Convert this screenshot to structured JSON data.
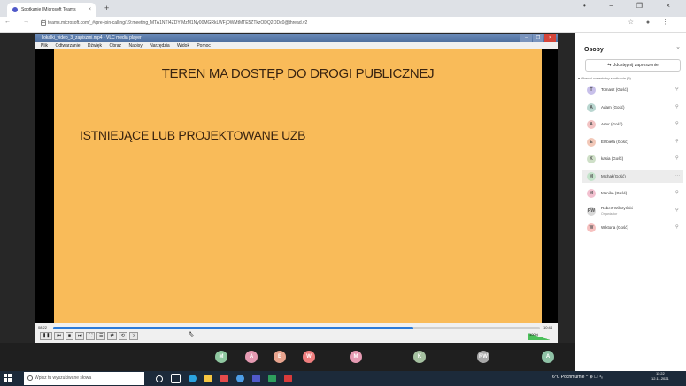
{
  "browser": {
    "tab_title": "Spotkanie (Microsoft Teams",
    "new_tab": "+",
    "url": "teams.microsoft.com/_#/pre-join-calling/19:meeting_MTA1NTI4ZDYtMzM1Ny00MGRkLWFjOWMtMTE5ZTkzODQ2ODc0@thread.v2",
    "nav": "← → C",
    "window_controls": "• − ❐ ×",
    "addr_icons": "☆ ● ⋮"
  },
  "vlc": {
    "title": "lokalki_video_3_zapiszmi.mp4 - VLC media player",
    "menu": [
      "Plik",
      "Odtwarzanie",
      "Dźwięk",
      "Obraz",
      "Napisy",
      "Narzędzia",
      "Widok",
      "Pomoc"
    ],
    "time_elapsed": "08:22",
    "time_total": "10:44",
    "progress": 0.74,
    "volume": "100%",
    "buttons": [
      "❚❚",
      "⏮",
      "■",
      "⏭",
      "⛶",
      "☰",
      "⇄",
      "⟲",
      "⤨"
    ]
  },
  "slide": {
    "title": "TEREN MA DOSTĘP DO DROGI PUBLICZNEJ",
    "bullet": "ISTNIEJĄCE LUB PROJEKTOWANE UZB"
  },
  "meeting_avatars": [
    {
      "initials": "M",
      "color": "#8fc7a0"
    },
    {
      "initials": "A",
      "color": "#e59ab2"
    },
    {
      "initials": "E",
      "color": "#e8a48e"
    },
    {
      "initials": "W",
      "color": "#ef7e7e"
    },
    {
      "initials": "M",
      "color": "#e59ab2"
    },
    {
      "initials": "K",
      "color": "#a5c0a0"
    },
    {
      "initials": "RW",
      "color": "#a8a8a8"
    },
    {
      "initials": "A",
      "color": "#8fc2a6"
    }
  ],
  "panel": {
    "title": "Osoby",
    "close": "×",
    "share_button": "Udostępnij zaproszenie",
    "section_label": "Obecni uczestnicy spotkania (9)",
    "participants": [
      {
        "initials": "T",
        "name": "Tomasz (Gość)",
        "color": "#c8c0ea"
      },
      {
        "initials": "A",
        "name": "Adam (Gość)",
        "color": "#b9d6d0"
      },
      {
        "initials": "A",
        "name": "Artur (Gość)",
        "color": "#f2c3c3"
      },
      {
        "initials": "E",
        "name": "Elżbieta (Gość)",
        "color": "#f2c8b8"
      },
      {
        "initials": "K",
        "name": "kasia (Gość)",
        "color": "#cfe0c8"
      },
      {
        "initials": "M",
        "name": "Michał (Gość)",
        "color": "#c4e3cb"
      },
      {
        "initials": "M",
        "name": "Monika (Gość)",
        "color": "#f2c0cf"
      },
      {
        "initials": "RW",
        "name": "Robert Wilczyński",
        "color": "#d8d8d8",
        "sub": "Organizator"
      },
      {
        "initials": "W",
        "name": "Wiktoria (Gość)",
        "color": "#f6c0bf"
      }
    ]
  },
  "taskbar": {
    "search_placeholder": "Wpisz tu wyszukiwane słowa",
    "tray": "6°C Pochmurnie  ^ ⊕ ☐ ⁴ₓ",
    "time": "11:22",
    "date": "12.11.2021"
  }
}
